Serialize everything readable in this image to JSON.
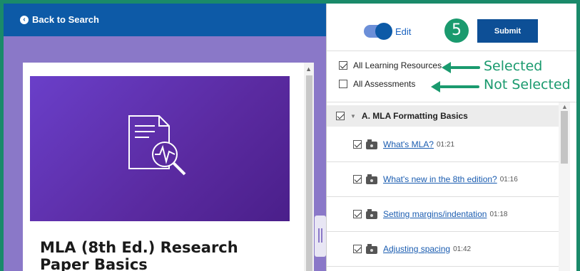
{
  "left_pane": {
    "back_label": "Back to Search",
    "course_title": "MLA (8th Ed.) Research Paper Basics"
  },
  "right_pane": {
    "edit_label": "Edit",
    "step_number": "5",
    "submit_label": "Submit",
    "filters": [
      {
        "label": "All Learning Resources",
        "checked": true,
        "callout": "Selected"
      },
      {
        "label": "All Assessments",
        "checked": false,
        "callout": "Not Selected"
      }
    ],
    "section": {
      "title": "A. MLA Formatting Basics",
      "items": [
        {
          "label": "What's MLA?",
          "duration": "01:21",
          "checked": true
        },
        {
          "label": "What's new in the 8th edition?",
          "duration": "01:16",
          "checked": true
        },
        {
          "label": "Setting margins/indentation",
          "duration": "01:18",
          "checked": true
        },
        {
          "label": "Adjusting spacing",
          "duration": "01:42",
          "checked": true
        }
      ]
    }
  },
  "colors": {
    "frame_border": "#1a8a6a",
    "topbar": "#0d5aa7",
    "callout_green": "#1a9a6e",
    "submit_bg": "#0d4f96",
    "link": "#1a5cb0"
  }
}
